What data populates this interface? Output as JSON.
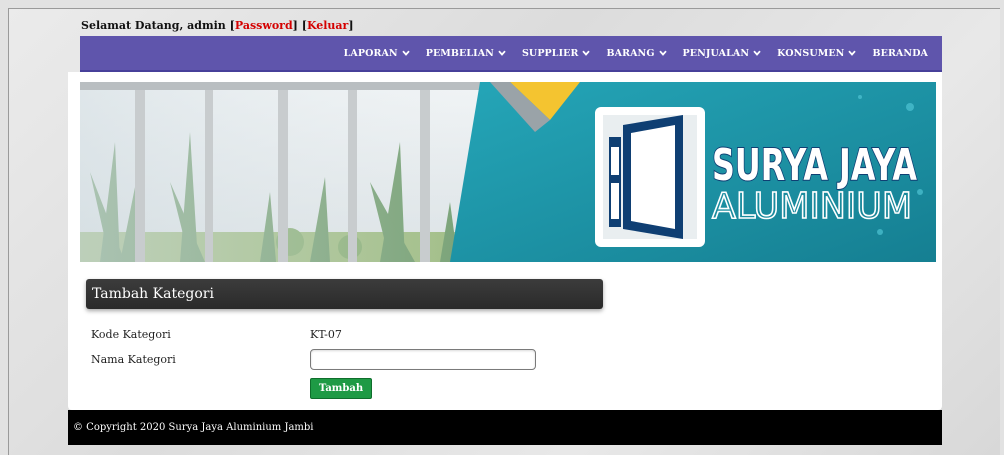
{
  "topbar": {
    "greeting": "Selamat Datang, admin",
    "password_link": "Password",
    "logout_link": "Keluar",
    "bracket_open": "[",
    "bracket_close": "]"
  },
  "nav": {
    "items": [
      {
        "label": "LAPORAN",
        "dropdown": true
      },
      {
        "label": "PEMBELIAN",
        "dropdown": true
      },
      {
        "label": "SUPPLIER",
        "dropdown": true
      },
      {
        "label": "BARANG",
        "dropdown": true
      },
      {
        "label": "PENJUALAN",
        "dropdown": true
      },
      {
        "label": "KONSUMEN",
        "dropdown": true
      },
      {
        "label": "BERANDA",
        "dropdown": false
      }
    ]
  },
  "banner": {
    "brand_line1": "SURYA JAYA",
    "brand_line2": "ALUMINIUM"
  },
  "form": {
    "title": "Tambah Kategori",
    "code_label": "Kode Kategori",
    "code_value": "KT-07",
    "name_label": "Nama Kategori",
    "name_value": "",
    "submit_label": "Tambah"
  },
  "footer": {
    "copyright": "© Copyright 2020 Surya Jaya Aluminium Jambi"
  },
  "colors": {
    "navbar": "#5f55ac",
    "link_red": "#d40000",
    "button_green": "#1e9a45",
    "banner_teal": "#1d9aae"
  }
}
